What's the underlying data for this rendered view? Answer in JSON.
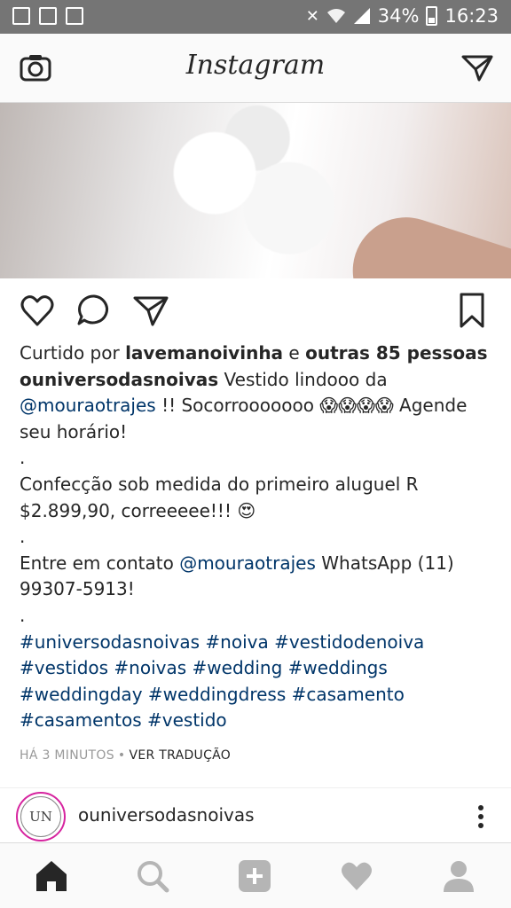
{
  "status_bar": {
    "battery_percent": "34%",
    "time": "16:23",
    "left_icons": [
      "image-icon",
      "file-icon",
      "download-icon"
    ],
    "right_icons": [
      "mute-icon",
      "wifi-icon",
      "signal-icon",
      "battery-icon"
    ]
  },
  "header": {
    "logo": "Instagram",
    "left_icon": "camera-icon",
    "right_icon": "direct-icon"
  },
  "post": {
    "liked_prefix": "Curtido por ",
    "liked_user": "lavemanoivinha",
    "liked_connector": " e ",
    "liked_others": "outras 85 pessoas",
    "author": "ouniversodasnoivas",
    "caption_1": " Vestido lindooo da",
    "mention_1": "@mouraotrajes",
    "caption_2": " !! Socorrooooooo 😱😱😱😱 Agende seu horário!",
    "dot_1": ".",
    "caption_3": "Confecção sob medida do primeiro aluguel  R $2.899,90, correeeee!!! 😍",
    "dot_2": ".",
    "caption_4": "Entre em contato  ",
    "mention_2": "@mouraotrajes",
    "caption_5": " WhatsApp (11) 99307-5913!",
    "dot_3": ".",
    "hashtags": "#universodasnoivas #noiva #vestidodenoiva #vestidos #noivas #wedding #weddings #weddingday #weddingdress #casamento #casamentos #vestido",
    "time_ago": "HÁ 3 MINUTOS",
    "separator": "•",
    "translate": "VER TRADUÇÃO"
  },
  "next_post": {
    "username": "ouniversodasnoivas",
    "avatar_text": "UN"
  },
  "bottom_nav": [
    "home-icon",
    "search-icon",
    "add-icon",
    "activity-icon",
    "profile-icon"
  ],
  "colors": {
    "status_bar": "#757575",
    "link": "#003569",
    "text": "#262626",
    "muted": "#999999",
    "story_ring": "#d6249f"
  }
}
